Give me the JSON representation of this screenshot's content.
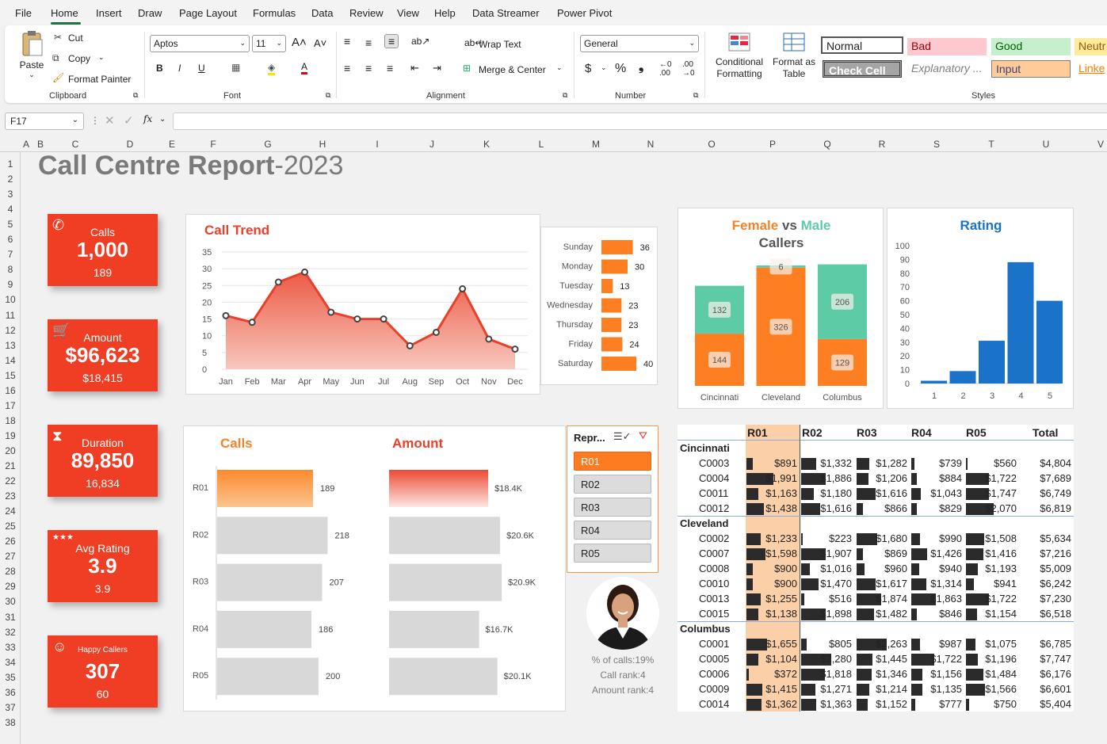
{
  "menu": [
    "File",
    "Home",
    "Insert",
    "Draw",
    "Page Layout",
    "Formulas",
    "Data",
    "Review",
    "View",
    "Help",
    "Data Streamer",
    "Power Pivot"
  ],
  "ribbon": {
    "paste": "Paste",
    "cut": "Cut",
    "copy": "Copy",
    "format_painter": "Format Painter",
    "clipboard": "Clipboard",
    "font_name": "Aptos",
    "font_size": "11",
    "font": "Font",
    "wrap_text": "Wrap Text",
    "merge_center": "Merge & Center",
    "alignment": "Alignment",
    "number_format": "General",
    "number": "Number",
    "conditional_formatting": "Conditional Formatting",
    "format_as_table": "Format as Table",
    "styles_label": "Styles",
    "styles": [
      "Normal",
      "Bad",
      "Good",
      "Neutr",
      "Check Cell",
      "Explanatory ...",
      "Input",
      "Linke"
    ]
  },
  "namebox": "F17",
  "fx": "fx",
  "columns": [
    "A",
    "B",
    "C",
    "D",
    "E",
    "F",
    "G",
    "H",
    "I",
    "J",
    "K",
    "L",
    "M",
    "N",
    "O",
    "P",
    "Q",
    "R",
    "S",
    "T",
    "U",
    "V"
  ],
  "rows": [
    "1",
    "2",
    "3",
    "4",
    "5",
    "6",
    "7",
    "8",
    "9",
    "10",
    "11",
    "12",
    "13",
    "14",
    "15",
    "16",
    "17",
    "18",
    "19",
    "20",
    "21",
    "22",
    "23",
    "24",
    "25",
    "26",
    "27",
    "28",
    "29",
    "30",
    "31",
    "32",
    "33",
    "34",
    "35",
    "36",
    "37",
    "38"
  ],
  "title": {
    "main": "Call Centre Report",
    "year": "-2023"
  },
  "kpis": [
    {
      "label": "Calls",
      "value": "1,000",
      "sub": "189",
      "icon": "phone-icon"
    },
    {
      "label": "Amount",
      "value": "$96,623",
      "sub": "$18,415",
      "icon": "cart-icon"
    },
    {
      "label": "Duration",
      "value": "89,850",
      "sub": "16,834",
      "icon": "hourglass-icon"
    },
    {
      "label": "Avg Rating",
      "value": "3.9",
      "sub": "3.9",
      "icon": "stars-icon"
    },
    {
      "label": "Happy Callers",
      "value": "307",
      "sub": "60",
      "icon": "smiley-icon"
    }
  ],
  "charts": {
    "trend_title": "Call Trend",
    "gender_title": {
      "a": "Female",
      "vs": " vs ",
      "b": "Male",
      "c": "Callers"
    },
    "rating_title": "Rating",
    "calls_title": "Calls",
    "amount_title": "Amount"
  },
  "chart_data": [
    {
      "type": "area",
      "title": "Call Trend",
      "categories": [
        "Jan",
        "Feb",
        "Mar",
        "Apr",
        "May",
        "Jun",
        "Jul",
        "Aug",
        "Sep",
        "Oct",
        "Nov",
        "Dec"
      ],
      "values": [
        16,
        14,
        26,
        29,
        17,
        15,
        15,
        7,
        11,
        24,
        9,
        6
      ],
      "ylim": [
        0,
        35
      ],
      "yticks": [
        0,
        5,
        10,
        15,
        20,
        25,
        30,
        35
      ]
    },
    {
      "type": "bar",
      "orientation": "horizontal",
      "categories": [
        "Sunday",
        "Monday",
        "Tuesday",
        "Wednesday",
        "Thursday",
        "Friday",
        "Saturday"
      ],
      "values": [
        36,
        30,
        13,
        23,
        23,
        24,
        40
      ]
    },
    {
      "type": "bar",
      "stacked": true,
      "title": "Female vs Male Callers",
      "categories": [
        "Cincinnati",
        "Cleveland",
        "Columbus"
      ],
      "series": [
        {
          "name": "Female",
          "values": [
            144,
            326,
            129
          ],
          "color": "#fd7f22"
        },
        {
          "name": "Male",
          "values": [
            132,
            6,
            206
          ],
          "color": "#5ecba7"
        }
      ]
    },
    {
      "type": "bar",
      "title": "Rating",
      "categories": [
        "1",
        "2",
        "3",
        "4",
        "5"
      ],
      "values": [
        2,
        9,
        31,
        88,
        60
      ],
      "ylim": [
        0,
        100
      ],
      "yticks": [
        0,
        10,
        20,
        30,
        40,
        50,
        60,
        70,
        80,
        90,
        100
      ]
    },
    {
      "type": "bar",
      "orientation": "horizontal",
      "title": "Calls",
      "categories": [
        "R01",
        "R02",
        "R03",
        "R04",
        "R05"
      ],
      "values": [
        189,
        218,
        207,
        186,
        200
      ]
    },
    {
      "type": "bar",
      "orientation": "horizontal",
      "title": "Amount",
      "categories": [
        "R01",
        "R02",
        "R03",
        "R04",
        "R05"
      ],
      "values": [
        18.4,
        20.6,
        20.9,
        16.7,
        20.1
      ],
      "labels": [
        "$18.4K",
        "$20.6K",
        "$20.9K",
        "$16.7K",
        "$20.1K"
      ]
    }
  ],
  "slicer": {
    "title": "Repr...",
    "items": [
      "R01",
      "R02",
      "R03",
      "R04",
      "R05"
    ],
    "selected": "R01"
  },
  "rep_info": [
    "% of calls:19%",
    "Call rank:4",
    "Amount rank:4"
  ],
  "pivot": {
    "headers": [
      "R01",
      "R02",
      "R03",
      "R04",
      "R05",
      "Total"
    ],
    "groups": [
      {
        "name": "Cincinnati",
        "rows": [
          {
            "id": "C0003",
            "vals": [
              "$891",
              "$1,332",
              "$1,282",
              "$739",
              "$560"
            ],
            "total": "$4,804",
            "bars": [
              0.12,
              0.28,
              0.24,
              0.06,
              0
            ]
          },
          {
            "id": "C0004",
            "vals": [
              "$1,991",
              "$1,886",
              "$1,206",
              "$884",
              "$1,722"
            ],
            "total": "$7,689",
            "bars": [
              0.5,
              0.46,
              0.22,
              0.1,
              0.42
            ]
          },
          {
            "id": "C0011",
            "vals": [
              "$1,163",
              "$1,180",
              "$1,616",
              "$1,043",
              "$1,747"
            ],
            "total": "$6,749",
            "bars": [
              0.22,
              0.24,
              0.36,
              0.18,
              0.42
            ]
          },
          {
            "id": "C0012",
            "vals": [
              "$1,438",
              "$1,616",
              "$866",
              "$829",
              "$2,070"
            ],
            "total": "$6,819",
            "bars": [
              0.32,
              0.36,
              0.12,
              0.1,
              0.52
            ]
          }
        ]
      },
      {
        "name": "Cleveland",
        "rows": [
          {
            "id": "C0002",
            "vals": [
              "$1,233",
              "$223",
              "$1,680",
              "$990",
              "$1,508"
            ],
            "total": "$5,634",
            "bars": [
              0.26,
              0.02,
              0.38,
              0.16,
              0.34
            ]
          },
          {
            "id": "C0007",
            "vals": [
              "$1,598",
              "$1,907",
              "$869",
              "$1,426",
              "$1,416"
            ],
            "total": "$7,216",
            "bars": [
              0.36,
              0.46,
              0.12,
              0.3,
              0.32
            ]
          },
          {
            "id": "C0008",
            "vals": [
              "$900",
              "$1,016",
              "$960",
              "$940",
              "$1,193"
            ],
            "total": "$5,009",
            "bars": [
              0.12,
              0.16,
              0.14,
              0.14,
              0.22
            ]
          },
          {
            "id": "C0010",
            "vals": [
              "$900",
              "$1,470",
              "$1,617",
              "$1,314",
              "$941"
            ],
            "total": "$6,242",
            "bars": [
              0.12,
              0.32,
              0.36,
              0.28,
              0.14
            ]
          },
          {
            "id": "C0013",
            "vals": [
              "$1,255",
              "$516",
              "$1,874",
              "$1,863",
              "$1,722"
            ],
            "total": "$7,230",
            "bars": [
              0.26,
              0.06,
              0.46,
              0.46,
              0.42
            ]
          },
          {
            "id": "C0015",
            "vals": [
              "$1,138",
              "$1,898",
              "$1,482",
              "$846",
              "$1,154"
            ],
            "total": "$6,518",
            "bars": [
              0.22,
              0.46,
              0.32,
              0.1,
              0.2
            ]
          }
        ]
      },
      {
        "name": "Columbus",
        "rows": [
          {
            "id": "C0001",
            "vals": [
              "$1,655",
              "$805",
              "$2,263",
              "$987",
              "$1,075"
            ],
            "total": "$6,785",
            "bars": [
              0.38,
              0.1,
              0.56,
              0.16,
              0.18
            ]
          },
          {
            "id": "C0005",
            "vals": [
              "$1,104",
              "$2,280",
              "$1,445",
              "$1,722",
              "$1,196"
            ],
            "total": "$7,747",
            "bars": [
              0.22,
              0.56,
              0.3,
              0.42,
              0.22
            ]
          },
          {
            "id": "C0006",
            "vals": [
              "$372",
              "$1,818",
              "$1,346",
              "$1,156",
              "$1,484"
            ],
            "total": "$6,176",
            "bars": [
              0.04,
              0.44,
              0.28,
              0.2,
              0.32
            ]
          },
          {
            "id": "C0009",
            "vals": [
              "$1,415",
              "$1,271",
              "$1,214",
              "$1,135",
              "$1,566"
            ],
            "total": "$6,601",
            "bars": [
              0.3,
              0.26,
              0.24,
              0.2,
              0.36
            ]
          },
          {
            "id": "C0014",
            "vals": [
              "$1,362",
              "$1,363",
              "$1,152",
              "$777",
              "$750"
            ],
            "total": "$5,404",
            "bars": [
              0.28,
              0.28,
              0.2,
              0.08,
              0.06
            ]
          }
        ]
      }
    ]
  }
}
